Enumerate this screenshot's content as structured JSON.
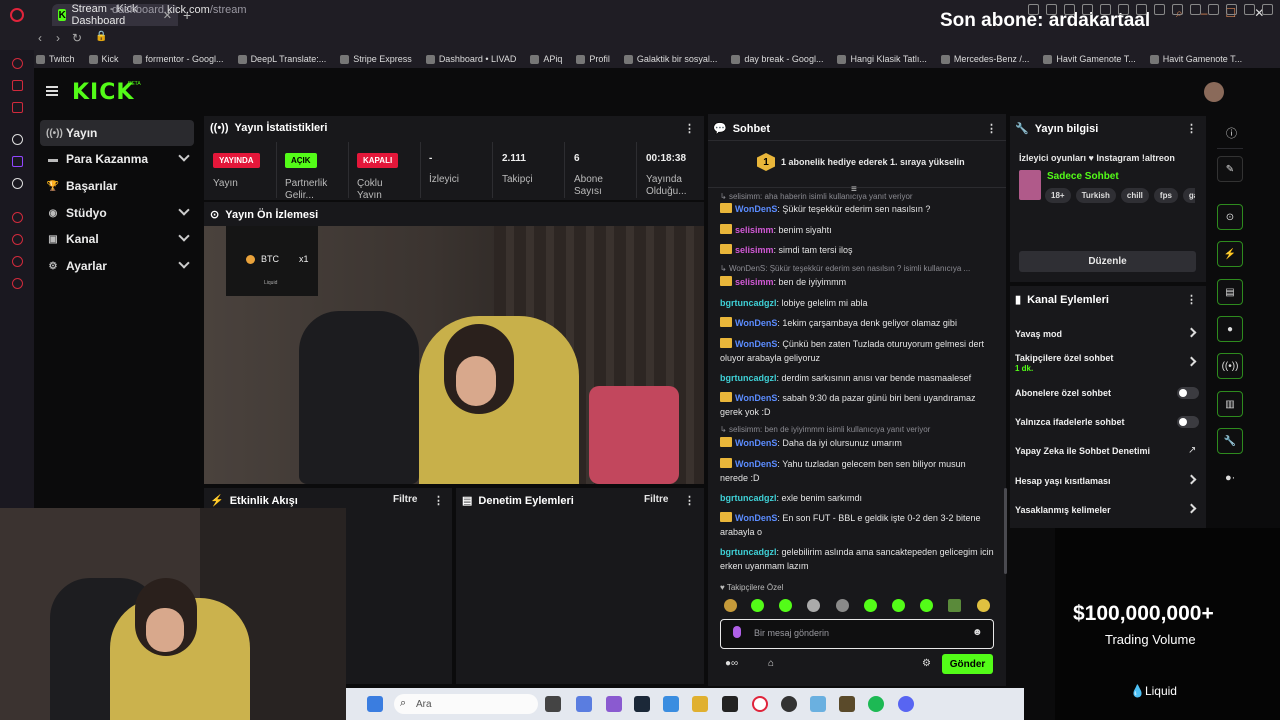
{
  "browser": {
    "tab_title": "Stream - Kick Dashboard",
    "url_prefix": "dashboard.",
    "url_domain": "kick.com",
    "url_path": "/stream",
    "bookmarks": [
      "Twitch",
      "Kick",
      "formentor - Googl...",
      "DeepL Translate:...",
      "Stripe Express",
      "Dashboard • LIVAD",
      "APiq",
      "Profil",
      "Galaktik bir sosyal...",
      "day break - Googl...",
      "Hangi Klasik Tatlı...",
      "Mercedes-Benz /...",
      "Havit Gamenote T...",
      "Havit Gamenote T..."
    ]
  },
  "overlay": {
    "title": "Son abone: ardakartaal"
  },
  "kick": {
    "logo": "KICK",
    "beta": "BETA"
  },
  "nav": {
    "items": [
      {
        "label": "Yayın",
        "icon": "broadcast-icon"
      },
      {
        "label": "Para Kazanma",
        "icon": "money-icon"
      },
      {
        "label": "Başarılar",
        "icon": "trophy-icon"
      },
      {
        "label": "Stüdyo",
        "icon": "studio-icon"
      },
      {
        "label": "Kanal",
        "icon": "channel-icon"
      },
      {
        "label": "Ayarlar",
        "icon": "gear-icon"
      }
    ]
  },
  "stats": {
    "title": "Yayın İstatistikleri",
    "items": [
      {
        "badge": "YAYINDA",
        "label": "Yayın"
      },
      {
        "badge": "AÇIK",
        "label": "Partnerlik Gelir..."
      },
      {
        "badge": "KAPALI",
        "label": "Çoklu Yayın"
      },
      {
        "value": "-",
        "label": "İzleyici"
      },
      {
        "value": "2.111",
        "label": "Takipçi"
      },
      {
        "value": "6",
        "label": "Abone Sayısı"
      },
      {
        "value": "00:18:38",
        "label": "Yayında Olduğu..."
      }
    ]
  },
  "preview": {
    "title": "Yayın Ön İzlemesi",
    "btc_label": "BTC",
    "btc_mult": "x1",
    "btc_brand": "Liquid"
  },
  "activity": {
    "title": "Etkinlik Akışı",
    "filter": "Filtre"
  },
  "moderation": {
    "title": "Denetim Eylemleri",
    "filter": "Filtre"
  },
  "chat": {
    "title": "Sohbet",
    "pinned": "1 abonelik hediye ederek 1. sıraya yükselin",
    "pinned_rank": "1",
    "messages": [
      {
        "type": "reply",
        "text": "selisimm: aha haberin isimli kullanıcıya yanıt veriyor"
      },
      {
        "user": "WonDenS",
        "color": "#5b8cff",
        "text": "Şükür teşekkür ederim sen nasılsın ?",
        "crown": true
      },
      {
        "user": "selisimm",
        "color": "#d25ad6",
        "text": "benim siyahtı",
        "crown": true
      },
      {
        "user": "selisimm",
        "color": "#d25ad6",
        "text": "simdi tam tersi iloş",
        "crown": true
      },
      {
        "type": "reply",
        "text": "WonDenS: Şükür teşekkür ederim sen nasılsın ? isimli kullanıcıya ..."
      },
      {
        "user": "selisimm",
        "color": "#d25ad6",
        "text": "ben de iyiyimmm",
        "crown": true
      },
      {
        "user": "bgrtuncadgzl",
        "color": "#3fd0d6",
        "text": "lobiye gelelim mi abla",
        "crown": false
      },
      {
        "user": "WonDenS",
        "color": "#5b8cff",
        "text": "1ekim çarşambaya denk geliyor olamaz gibi",
        "crown": true
      },
      {
        "user": "WonDenS",
        "color": "#5b8cff",
        "text": "Çünkü ben zaten Tuzlada oturuyorum gelmesi dert oluyor arabayla geliyoruz",
        "crown": true
      },
      {
        "user": "bgrtuncadgzl",
        "color": "#3fd0d6",
        "text": "derdim sarkısının anısı var bende masmaalesef",
        "crown": false
      },
      {
        "user": "WonDenS",
        "color": "#5b8cff",
        "text": "sabah 9:30 da pazar günü biri beni uyandıramaz gerek yok :D",
        "crown": true
      },
      {
        "type": "reply",
        "text": "selisimm: ben de iyiyimmm isimli kullanıcıya yanıt veriyor"
      },
      {
        "user": "WonDenS",
        "color": "#5b8cff",
        "text": "Daha da iyi olursunuz umarım",
        "crown": true
      },
      {
        "user": "WonDenS",
        "color": "#5b8cff",
        "text": "Yahu tuzladan gelecem ben sen biliyor musun nerede :D",
        "crown": true
      },
      {
        "user": "bgrtuncadgzl",
        "color": "#3fd0d6",
        "text": "exle benim sarkımdı",
        "crown": false
      },
      {
        "user": "WonDenS",
        "color": "#5b8cff",
        "text": "En son FUT - BBL e geldik işte 0-2 den 3-2 bitene arabayla o",
        "crown": true
      },
      {
        "user": "bgrtuncadgzl",
        "color": "#3fd0d6",
        "text": "gelebilirim aslında ama sancaktepeden gelicegim icin erken uyanmam lazım",
        "crown": false
      }
    ],
    "followers_only_label": "Takipçilere Özel",
    "input_placeholder": "Bir mesaj gönderin",
    "send_label": "Gönder"
  },
  "info": {
    "title": "Yayın bilgisi",
    "stream_title": "İzleyici oyunları ♥ Instagram !altreon",
    "category": "Sadece Sohbet",
    "tags": [
      "18+",
      "Turkish",
      "chill",
      "fps",
      "ga"
    ],
    "edit_label": "Düzenle"
  },
  "actions": {
    "title": "Kanal Eylemleri",
    "items": [
      {
        "label": "Yavaş mod",
        "control": "chevron"
      },
      {
        "label": "Takipçilere özel sohbet",
        "sub": "1 dk.",
        "control": "chevron"
      },
      {
        "label": "Abonelere özel sohbet",
        "control": "toggle"
      },
      {
        "label": "Yalnızca ifadelerle sohbet",
        "control": "toggle"
      },
      {
        "label": "Yapay Zeka ile Sohbet Denetimi",
        "control": "external"
      },
      {
        "label": "Hesap yaşı kısıtlaması",
        "control": "chevron"
      },
      {
        "label": "Yasaklanmış kelimeler",
        "control": "chevron"
      }
    ]
  },
  "ad": {
    "amount": "$100,000,000+",
    "sub": "Trading Volume",
    "brand": "Liquid"
  },
  "taskbar": {
    "search": "Ara"
  },
  "colors": {
    "kick_green": "#53fc18",
    "panel": "#18181b",
    "live_red": "#e4173a"
  }
}
